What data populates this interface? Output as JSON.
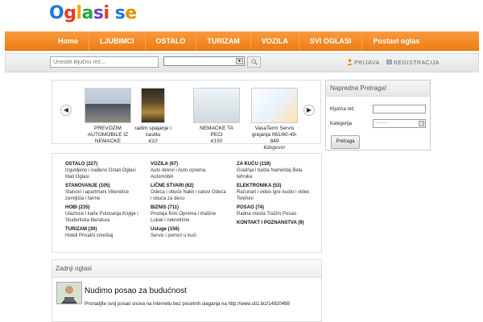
{
  "logo": {
    "letters": [
      "O",
      "g",
      "l",
      "a",
      "s",
      "i",
      " ",
      "s",
      "e"
    ],
    "colors": [
      "#1f77d8",
      "#e9391f",
      "#f5a300",
      "#28a745",
      "#7b3fb8",
      "#e9391f",
      "#000000",
      "#1f77d8",
      "#e98f00"
    ]
  },
  "nav": {
    "items": [
      "Home",
      "LJUBIMCI",
      "OSTALO",
      "TURIZAM",
      "VOZILA",
      "SVI OGLASI",
      "Postavi oglas"
    ]
  },
  "search": {
    "placeholder": "Unesite ključnu reč...",
    "prijava": "PRIJAVA",
    "registracija": "REGISTRACIJA"
  },
  "carousel": {
    "items": [
      {
        "title": "PREVOZIM AUTOMOBILE IZ NEMACKE",
        "price": ""
      },
      {
        "title": "radim spajanje i zastitu",
        "price": "€10"
      },
      {
        "title": "NEMACKE TA PECI",
        "price": "€150"
      },
      {
        "title": "VasaTerm Servis grejanja 061/60-49-849",
        "price": "€dogovor"
      }
    ]
  },
  "side": {
    "title": "Napredna Pretraga!",
    "keyword_label": "Ključna reč",
    "category_label": "Kategorija",
    "category_value": "--------",
    "button": "Pretraga"
  },
  "categories": {
    "col1": [
      {
        "title": "OSTALO (227)",
        "sub": "Izgubljeno i nađeno Ostali Oglasi Mali Oglasi"
      },
      {
        "title": "STANOVANJE (105)",
        "sub": "Stanovi i apartmani Vikendice zemljišta i farme"
      },
      {
        "title": "HOBI (235)",
        "sub": "Ulaznice i karte Putovanja Knjige i Studentska literatura"
      },
      {
        "title": "TURIZAM (30)",
        "sub": "Hoteli Privatni smeštaj"
      }
    ],
    "col2": [
      {
        "title": "VOZILA (67)",
        "sub": "Auto delovi i Auto oprema Automobili"
      },
      {
        "title": "LIČNE STVARI (62)",
        "sub": "Odeća i obuće Nakit i satovi Odeća i obuća za decu"
      },
      {
        "title": "BIZNIS (711)",
        "sub": "Prodaja firmi Oprema i mašine Lokali i nekretnine"
      },
      {
        "title": "Usluge (156)",
        "sub": "Servis i pomoć u kući"
      }
    ],
    "col3": [
      {
        "title": "ZA KUĆU (119)",
        "sub": "Gradnja i bašta Nameštaj Bela tehnika"
      },
      {
        "title": "ELEKTRONIKA (53)",
        "sub": "Računari i video igre Audio i video Telefoni"
      },
      {
        "title": "POSAO (74)",
        "sub": "Radna mesta Tražim Posao"
      },
      {
        "title": "KONTAKT I POZNANSTVA (9)",
        "sub": ""
      }
    ]
  },
  "latest": {
    "title": "Zadnji oglasi",
    "ad_title": "Nudimo posao za budućnost",
    "ad_desc": "Pronadjite svoj posao snova na internetu bez pocetnih ulaganja na http://www.sti1.biz/14920498"
  }
}
